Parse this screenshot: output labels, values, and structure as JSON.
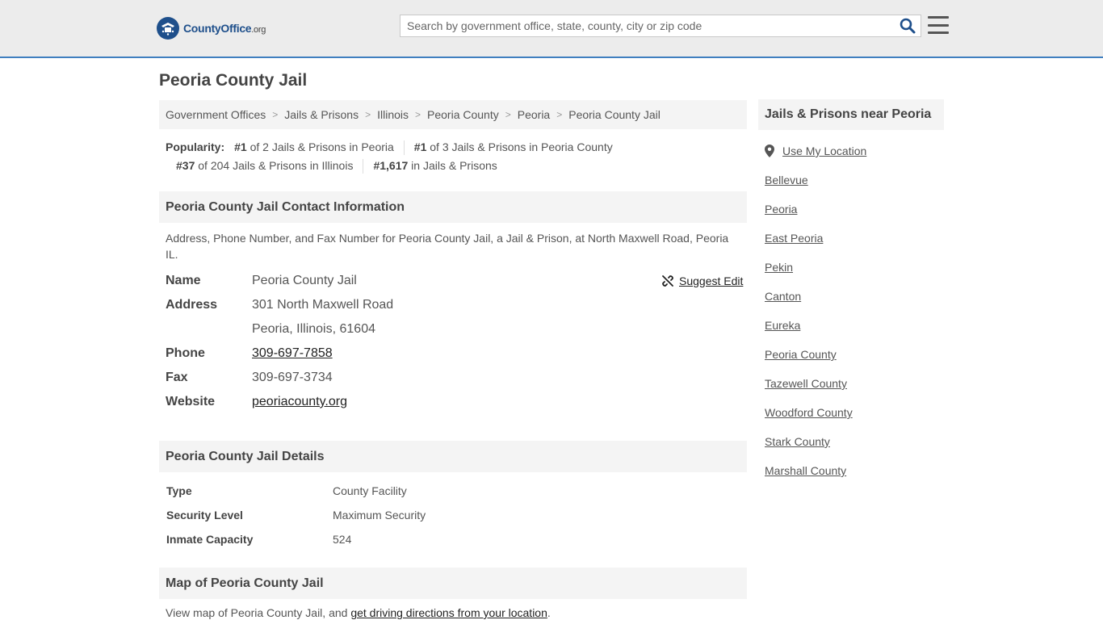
{
  "header": {
    "logo": {
      "brand": "CountyOffice",
      "tld": ".org"
    },
    "search": {
      "placeholder": "Search by government office, state, county, city or zip code"
    }
  },
  "page": {
    "title": "Peoria County Jail"
  },
  "breadcrumb": [
    "Government Offices",
    "Jails & Prisons",
    "Illinois",
    "Peoria County",
    "Peoria",
    "Peoria County Jail"
  ],
  "popularity": {
    "label": "Popularity:",
    "items": [
      {
        "rank": "#1",
        "text": " of 2 Jails & Prisons in Peoria"
      },
      {
        "rank": "#1",
        "text": " of 3 Jails & Prisons in Peoria County"
      },
      {
        "rank": "#37",
        "text": " of 204 Jails & Prisons in Illinois"
      },
      {
        "rank": "#1,617",
        "text": " in Jails & Prisons"
      }
    ]
  },
  "contact": {
    "heading": "Peoria County Jail Contact Information",
    "description": "Address, Phone Number, and Fax Number for Peoria County Jail, a Jail & Prison, at North Maxwell Road, Peoria IL.",
    "suggest_edit": "Suggest Edit",
    "name_label": "Name",
    "name": "Peoria County Jail",
    "address_label": "Address",
    "address1": "301 North Maxwell Road",
    "address2": "Peoria, Illinois, 61604",
    "phone_label": "Phone",
    "phone": "309-697-7858",
    "fax_label": "Fax",
    "fax": "309-697-3734",
    "website_label": "Website",
    "website": "peoriacounty.org"
  },
  "details": {
    "heading": "Peoria County Jail Details",
    "rows": [
      {
        "label": "Type",
        "value": "County Facility"
      },
      {
        "label": "Security Level",
        "value": "Maximum Security"
      },
      {
        "label": "Inmate Capacity",
        "value": "524"
      }
    ]
  },
  "map": {
    "heading": "Map of Peoria County Jail",
    "desc_prefix": "View map of Peoria County Jail, and ",
    "desc_link": "get driving directions from your location",
    "desc_suffix": "."
  },
  "sidebar": {
    "heading": "Jails & Prisons near Peoria",
    "use_location": "Use My Location",
    "links": [
      "Bellevue",
      "Peoria",
      "East Peoria",
      "Pekin",
      "Canton",
      "Eureka",
      "Peoria County",
      "Tazewell County",
      "Woodford County",
      "Stark County",
      "Marshall County"
    ]
  },
  "colors": {
    "brand": "#1e4f8b",
    "accent_border": "#3f7fbf"
  }
}
